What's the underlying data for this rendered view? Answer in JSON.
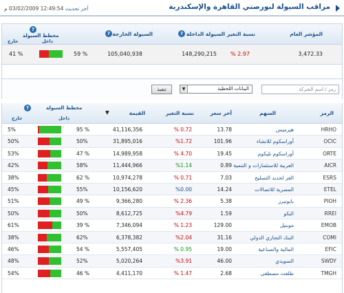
{
  "header": {
    "title": "مراقب السيولة لبورصتي القاهرة والإسكندرية",
    "update_label": "آخر تحديث",
    "update_value": "12:49:54 03/02/2009 م"
  },
  "summary": {
    "headers": {
      "index": "المؤشر العام",
      "change": "نسبة التغير",
      "inflow": "السيولة الداخلة",
      "outflow": "السيولة الخارجة",
      "liquidity": "مخطط السيولة",
      "in": "داخل",
      "out": "خارج"
    },
    "values": {
      "index": "3,472.33",
      "change": "% 2.97",
      "inflow": "148,290,215",
      "outflow": "105,040,938",
      "in_pct": "59 %",
      "out_pct": "41 %",
      "in_ratio": 0.59
    }
  },
  "filters": {
    "search_placeholder": "رمز / اسم الشركة",
    "select_value": "البيانات اللحظية",
    "button": "تنفيذ"
  },
  "table": {
    "headers": {
      "symbol": "الرمز",
      "name": "السهم",
      "last": "آخر سعر",
      "change": "نسبة التغير",
      "value": "القيمة",
      "sort": "▼",
      "liquidity": "مخطط السيولة",
      "in": "داخل",
      "out": "خارج"
    },
    "rows": [
      {
        "symbol": "HRHO",
        "name": "هيرميس",
        "last": "13.78",
        "change": "% 0.72",
        "value": "41,116,356",
        "in": "95 %",
        "out": "5%",
        "in_ratio": 0.95,
        "color": "red"
      },
      {
        "symbol": "OCIC",
        "name": "أوراسكوم للانشاء",
        "last": "101.96",
        "change": "%1.72",
        "value": "31,895,016",
        "in": "50%",
        "out": "50%",
        "in_ratio": 0.5,
        "color": "red"
      },
      {
        "symbol": "ORTE",
        "name": "أوراسكوم تليكوم",
        "last": "19.45",
        "change": "% 4.70",
        "value": "14,989,958",
        "in": "47 %",
        "out": "53%",
        "in_ratio": 0.47,
        "color": "red"
      },
      {
        "symbol": "AICR",
        "name": "العربية للاستثمارات و التنمية",
        "last": "0.89",
        "change": "%1.14",
        "value": "11,444,966",
        "in": "58%",
        "out": "42%",
        "in_ratio": 0.58,
        "color": "green"
      },
      {
        "symbol": "ESRS",
        "name": "العز لحديد التسليح",
        "last": "7.03",
        "change": "% 0.71",
        "value": "10,974,278",
        "in": "62 %",
        "out": "38%",
        "in_ratio": 0.62,
        "color": "red"
      },
      {
        "symbol": "ETEL",
        "name": "المصرية للاتصالات",
        "last": "14.24",
        "change": "%0.00",
        "value": "10,156,620",
        "in": "55%",
        "out": "45%",
        "in_ratio": 0.55,
        "color": "blue"
      },
      {
        "symbol": "PIOH",
        "name": "بايونيرز",
        "last": "5.38",
        "change": "% 2.36",
        "value": "9,366,280",
        "in": "49 %",
        "out": "51%",
        "in_ratio": 0.49,
        "color": "red"
      },
      {
        "symbol": "RREI",
        "name": "اليكو",
        "last": "1.59",
        "change": "%4.79",
        "value": "8,612,725",
        "in": "50%",
        "out": "50%",
        "in_ratio": 0.5,
        "color": "red"
      },
      {
        "symbol": "EMOB",
        "name": "موبنيل",
        "last": "129.00",
        "change": "% 1.23",
        "value": "7,346,094",
        "in": "39 %",
        "out": "61%",
        "in_ratio": 0.39,
        "color": "red"
      },
      {
        "symbol": "COMI",
        "name": "البنك التجاري الدولي",
        "last": "31.16",
        "change": "%2.04",
        "value": "6,378,382",
        "in": "62%",
        "out": "38%",
        "in_ratio": 0.62,
        "color": "red"
      },
      {
        "symbol": "EFIC",
        "name": "المالية والصناعية",
        "last": "19.00",
        "change": "% 0.95",
        "value": "5,557,405",
        "in": "54 %",
        "out": "46%",
        "in_ratio": 0.54,
        "color": "green"
      },
      {
        "symbol": "SWDY",
        "name": "السويدي",
        "last": "46.00",
        "change": "%3.91",
        "value": "5,020,264",
        "in": "52%",
        "out": "48%",
        "in_ratio": 0.52,
        "color": "red"
      },
      {
        "symbol": "TMGH",
        "name": "طلعت مصطفى",
        "last": "2.68",
        "change": "% 1.47",
        "value": "4,411,170",
        "in": "46 %",
        "out": "54%",
        "in_ratio": 0.46,
        "color": "red"
      }
    ]
  },
  "colors": {
    "in": "#30c030",
    "out": "#e02020",
    "accent": "#1a4f8b"
  }
}
